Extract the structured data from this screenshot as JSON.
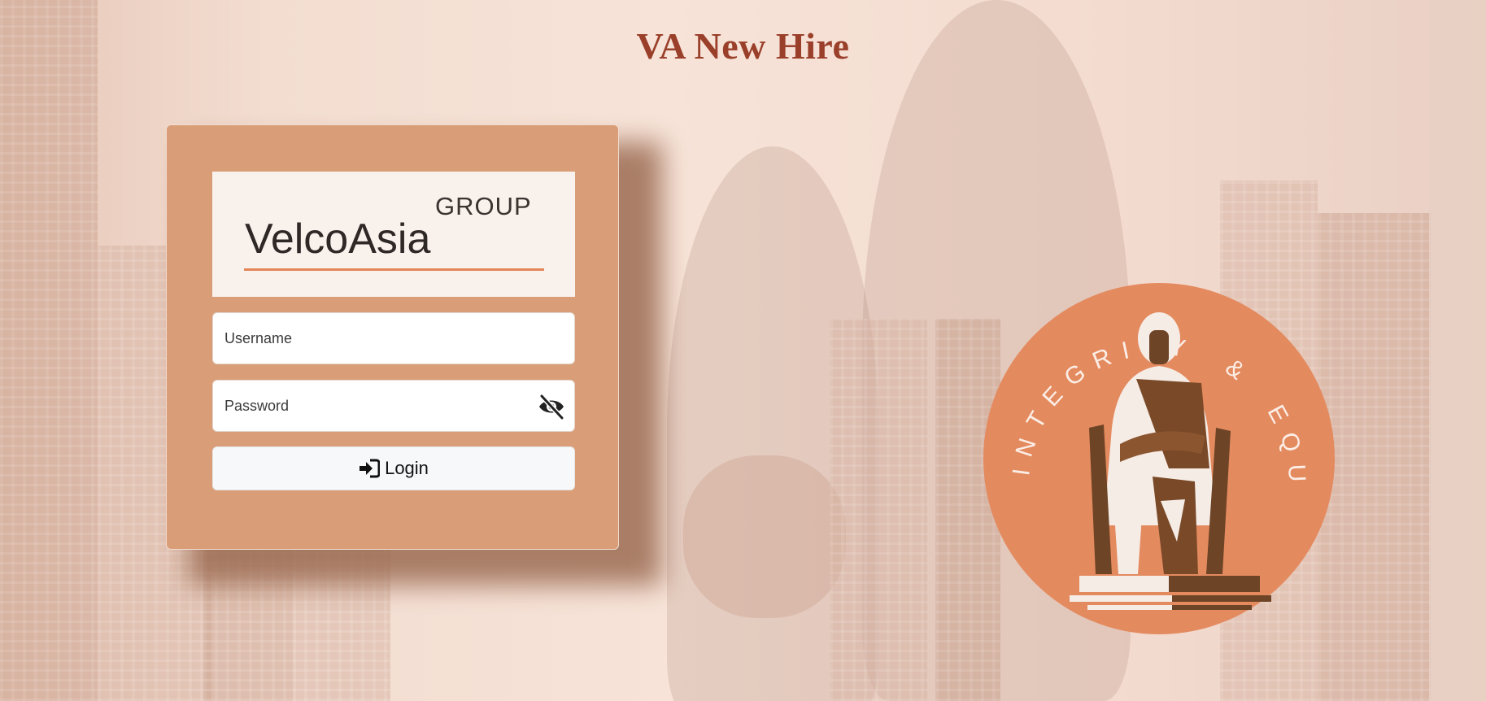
{
  "page": {
    "title": "VA New Hire"
  },
  "logo": {
    "group_text": "GROUP",
    "name_text": "VelcoAsia",
    "accent_color": "#e48557"
  },
  "form": {
    "username": {
      "placeholder": "Username",
      "value": ""
    },
    "password": {
      "placeholder": "Password",
      "value": "",
      "toggle_icon": "eye-slash-icon"
    },
    "login_button": {
      "label": "Login",
      "icon": "sign-in-icon"
    }
  },
  "seal": {
    "text_left": "INTEGRITY",
    "text_amp": "&",
    "text_right": "EQUITY",
    "color": "#e48a5f"
  },
  "colors": {
    "title": "#9a3f2a",
    "card": "#d99e77",
    "background": "#f5dfd3"
  }
}
